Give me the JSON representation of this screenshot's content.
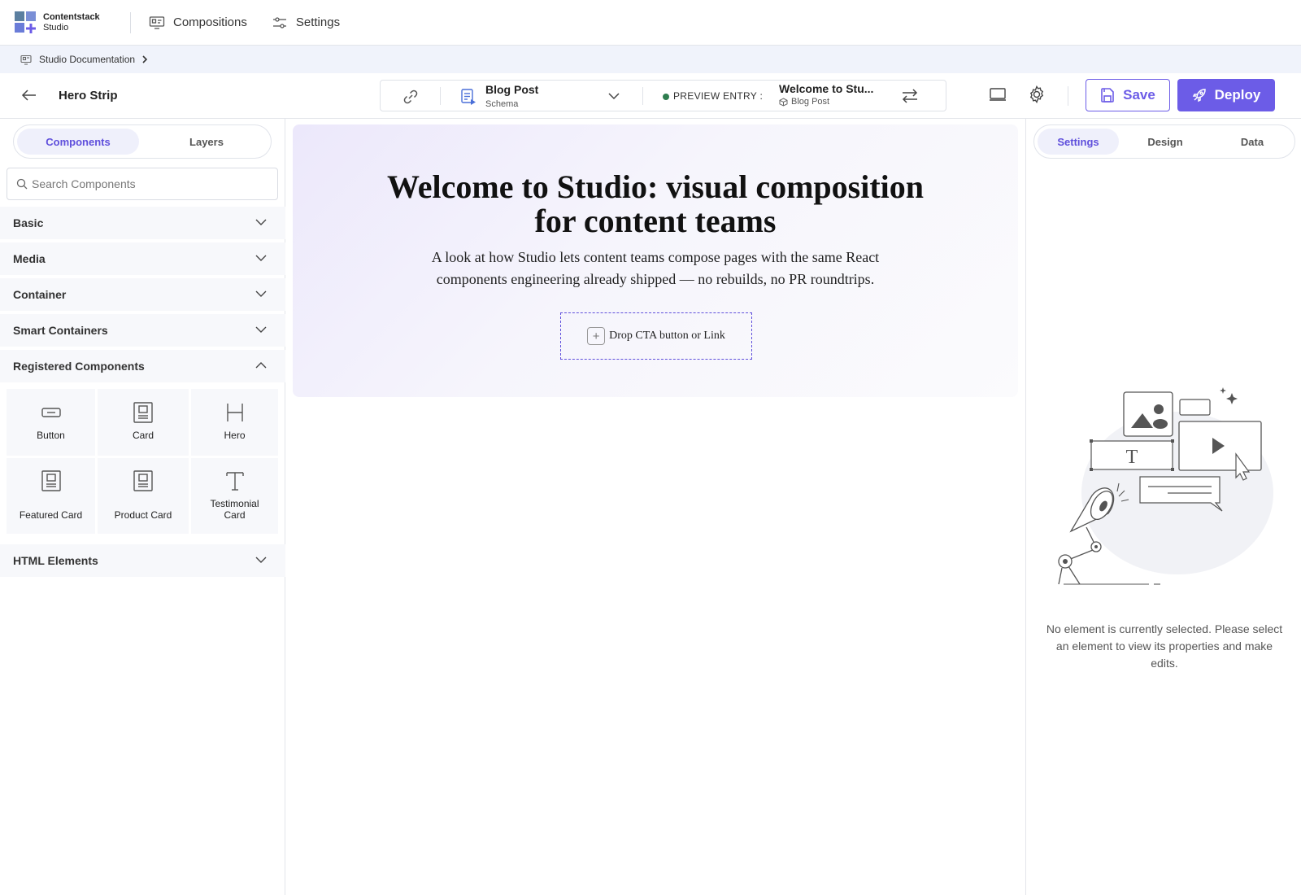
{
  "app": {
    "brand_line1": "Contentstack",
    "brand_line2": "Studio",
    "nav": [
      {
        "label": "Compositions",
        "icon": "compositions-icon"
      },
      {
        "label": "Settings",
        "icon": "sliders-icon"
      }
    ]
  },
  "breadcrumb": {
    "label": "Studio Documentation",
    "icon": "project-icon"
  },
  "toolbar": {
    "page_name": "Hero Strip",
    "schema_title": "Blog Post",
    "schema_sub": "Schema",
    "preview_label": "PREVIEW ENTRY :",
    "entry_title": "Welcome to Stu...",
    "entry_type": "Blog Post",
    "save_label": "Save",
    "deploy_label": "Deploy"
  },
  "left_panel": {
    "tabs": [
      "Components",
      "Layers"
    ],
    "active_tab": "Components",
    "search_placeholder": "Search Components",
    "sections": [
      "Basic",
      "Media",
      "Container",
      "Smart Containers",
      "Registered Components",
      "HTML Elements"
    ],
    "expanded_section": "Registered Components",
    "components": [
      {
        "label": "Button",
        "icon": "button-icon"
      },
      {
        "label": "Card",
        "icon": "card-icon"
      },
      {
        "label": "Hero",
        "icon": "hero-icon"
      },
      {
        "label": "Featured Card",
        "icon": "card-icon"
      },
      {
        "label": "Product Card",
        "icon": "card-icon"
      },
      {
        "label": "Testimonial Card",
        "icon": "text-icon"
      }
    ]
  },
  "canvas": {
    "hero_title": "Welcome to Studio: visual composition for content teams",
    "hero_subtitle": "A look at how Studio lets content teams compose pages with the same React components engineering already shipped — no rebuilds, no PR roundtrips.",
    "drop_label": "Drop CTA button or Link"
  },
  "right_panel": {
    "tabs": [
      "Settings",
      "Design",
      "Data"
    ],
    "active_tab": "Settings",
    "empty_message": "No element is currently selected. Please select an element to view its properties and make edits."
  },
  "colors": {
    "accent": "#6c5ce7",
    "accent_text": "#5f4fdc",
    "status_live": "#2e7d4f"
  }
}
